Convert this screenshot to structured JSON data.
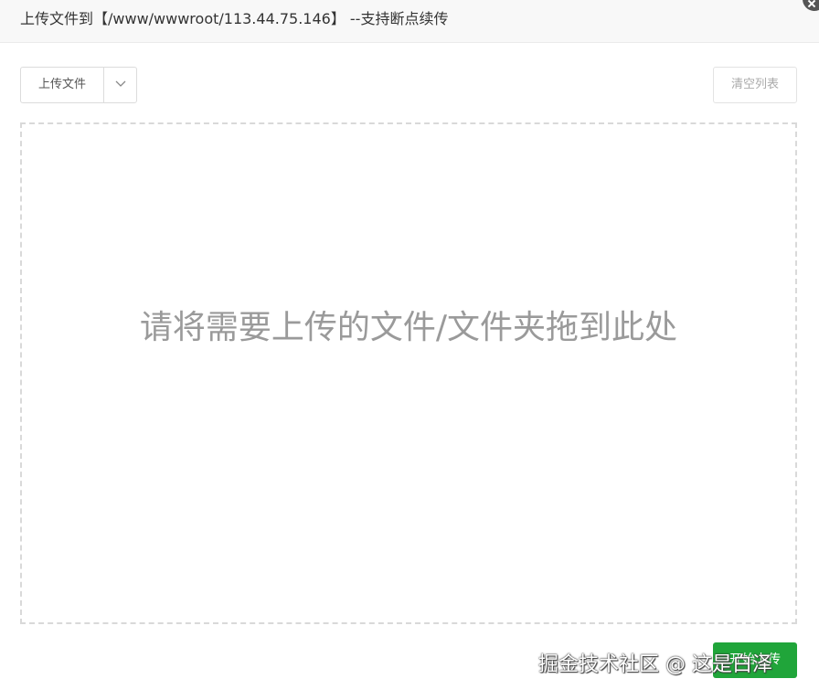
{
  "dialog": {
    "title": "上传文件到【/www/wwwroot/113.44.75.146】 --支持断点续传"
  },
  "toolbar": {
    "upload_label": "上传文件",
    "clear_label": "清空列表"
  },
  "dropzone": {
    "hint": "请将需要上传的文件/文件夹拖到此处"
  },
  "footer": {
    "start_label": "开始上传",
    "watermark": "掘金技术社区 @ 这是白泽"
  },
  "colors": {
    "accent": "#20a53a",
    "titlebar_bg": "#f8f8f8",
    "hint_text": "#9a9a9a"
  }
}
